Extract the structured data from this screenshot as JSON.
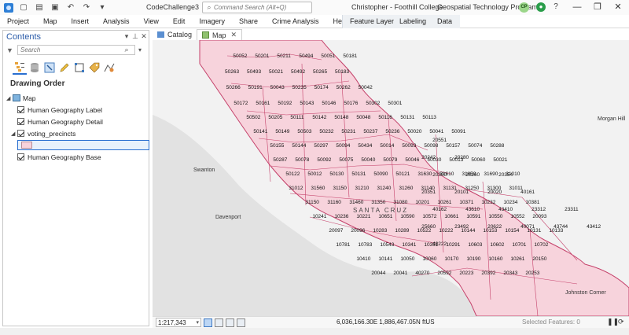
{
  "titlebar": {
    "doc_title": "CodeChallenge3",
    "search_placeholder": "Command Search (Alt+Q)",
    "user": "Christopher - Foothill College",
    "org": "Geospatial Technology Program",
    "avatar_initials": "CP",
    "minimize": "—",
    "restore": "❐",
    "close": "✕"
  },
  "ribbon": {
    "tabs": [
      "Project",
      "Map",
      "Insert",
      "Analysis",
      "View",
      "Edit",
      "Imagery",
      "Share",
      "Crime Analysis",
      "Help"
    ],
    "context_tabs": [
      "Feature Layer",
      "Labeling",
      "Data"
    ]
  },
  "contents": {
    "title": "Contents",
    "search_placeholder": "Search",
    "drawing_order": "Drawing Order",
    "map_name": "Map",
    "layers": [
      {
        "name": "Human Geography Label",
        "checked": true
      },
      {
        "name": "Human Geography Detail",
        "checked": true
      },
      {
        "name": "voting_precincts",
        "checked": true
      },
      {
        "name": "Human Geography Base",
        "checked": true
      }
    ]
  },
  "view_tabs": {
    "catalog": "Catalog",
    "map": "Map"
  },
  "map": {
    "places": [
      "Swanton",
      "Davenport",
      "Morgan Hill",
      "Johnston Corner"
    ],
    "county_label": "SANTA CRUZ",
    "colors": {
      "precinct_fill": "#f7d3dc",
      "precinct_stroke": "#c5426b",
      "ocean": "#e2e2e2",
      "land": "#f2f2f2"
    },
    "precinct_labels": [
      "50052",
      "50201",
      "50211",
      "50494",
      "50051",
      "50181",
      "50263",
      "50493",
      "50021",
      "50492",
      "50265",
      "50183",
      "50266",
      "50191",
      "50043",
      "50235",
      "50174",
      "50262",
      "50042",
      "50172",
      "50161",
      "50192",
      "50143",
      "50146",
      "50176",
      "50302",
      "50301",
      "50502",
      "50205",
      "50111",
      "50142",
      "50148",
      "50048",
      "50116",
      "50131",
      "50113",
      "50141",
      "50149",
      "50503",
      "50232",
      "50231",
      "50237",
      "50236",
      "50020",
      "50041",
      "50091",
      "50155",
      "50144",
      "50297",
      "50094",
      "50434",
      "50014",
      "50093",
      "50098",
      "50157",
      "50074",
      "50288",
      "50287",
      "50078",
      "50092",
      "50075",
      "50040",
      "50079",
      "50046",
      "50030",
      "50013",
      "50060",
      "50021",
      "50122",
      "50012",
      "50130",
      "50131",
      "50090",
      "50121",
      "31630",
      "31610",
      "31650",
      "31690",
      "31010",
      "31012",
      "31560",
      "31150",
      "31210",
      "31240",
      "31260",
      "31140",
      "31131",
      "31250",
      "31300",
      "31011",
      "31150",
      "31160",
      "31460",
      "31350",
      "31080",
      "10201",
      "10261",
      "10371",
      "10232",
      "10234",
      "10381",
      "10241",
      "10236",
      "10221",
      "10651",
      "10590",
      "10572",
      "10661",
      "10591",
      "10550",
      "10552",
      "20093",
      "20097",
      "20096",
      "10283",
      "10289",
      "10522",
      "10222",
      "10144",
      "10153",
      "10154",
      "10131",
      "10133",
      "10781",
      "10783",
      "10543",
      "10341",
      "10351",
      "10291",
      "10603",
      "10602",
      "10701",
      "10702",
      "10410",
      "10141",
      "10050",
      "10060",
      "10170",
      "10190",
      "10160",
      "10261",
      "20150",
      "20044",
      "20041",
      "40270",
      "20592",
      "20223",
      "20392",
      "20343",
      "20253",
      "20551",
      "20242",
      "20280",
      "20300",
      "20260",
      "20354",
      "20351",
      "20101",
      "20020",
      "40161",
      "40162",
      "43610",
      "43410",
      "23312",
      "23311",
      "25660",
      "23492",
      "20622",
      "40071",
      "43744",
      "43412",
      "40222"
    ]
  },
  "status": {
    "scale": "1:217,343",
    "coords": "6,036,166.30E 1,886,467.05N ftUS",
    "selected": "Selected Features: 0"
  }
}
